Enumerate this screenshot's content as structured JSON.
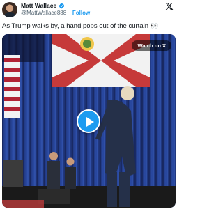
{
  "author": {
    "display_name": "Matt Wallace",
    "handle": "@MattWallace888",
    "separator": "·",
    "follow_label": "Follow"
  },
  "tweet": {
    "text": "As Trump walks by, a hand pops out of the curtain 👀"
  },
  "media": {
    "watch_label": "Watch on X"
  },
  "colors": {
    "accent": "#1d9bf0",
    "text": "#0f1419",
    "muted": "#536471"
  },
  "icons": [
    "verified-badge-icon",
    "x-logo-icon",
    "play-icon"
  ]
}
